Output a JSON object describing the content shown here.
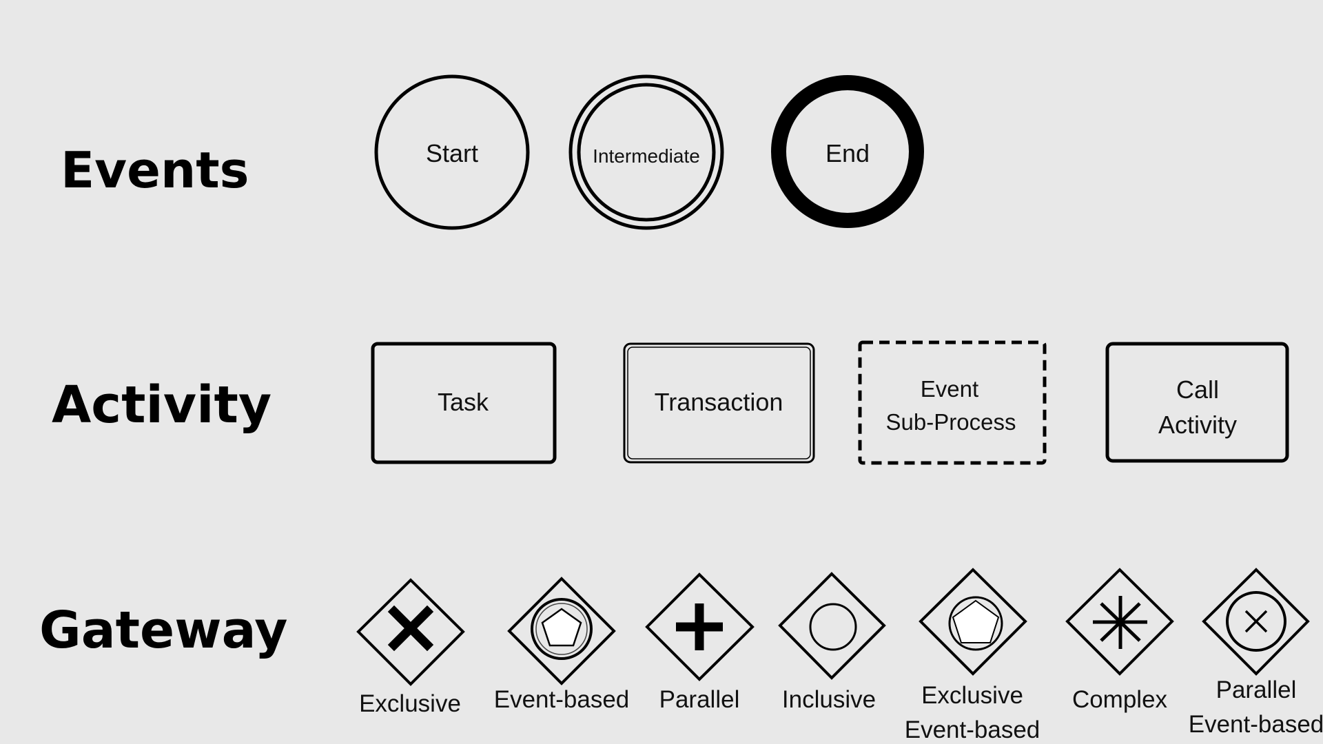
{
  "background_color": "#e8e8e8",
  "ink_color": "#000000",
  "sections": {
    "events": {
      "title": "Events",
      "items": [
        {
          "label": "Start",
          "shape": "circle-thin"
        },
        {
          "label": "Intermediate",
          "shape": "circle-double"
        },
        {
          "label": "End",
          "shape": "circle-thick"
        }
      ]
    },
    "activity": {
      "title": "Activity",
      "items": [
        {
          "label_lines": [
            "Task"
          ],
          "shape": "rounded-rect"
        },
        {
          "label_lines": [
            "Transaction"
          ],
          "shape": "rounded-rect-double"
        },
        {
          "label_lines": [
            "Event",
            "Sub-Process"
          ],
          "shape": "rounded-rect-dashed"
        },
        {
          "label_lines": [
            "Call",
            "Activity"
          ],
          "shape": "rounded-rect-thick"
        }
      ]
    },
    "gateway": {
      "title": "Gateway",
      "items": [
        {
          "label_lines": [
            "Exclusive"
          ],
          "marker": "x-bold-icon"
        },
        {
          "label_lines": [
            "Event-based"
          ],
          "marker": "double-circle-pentagon-icon"
        },
        {
          "label_lines": [
            "Parallel"
          ],
          "marker": "plus-bold-icon"
        },
        {
          "label_lines": [
            "Inclusive"
          ],
          "marker": "circle-icon"
        },
        {
          "label_lines": [
            "Exclusive",
            "Event-based"
          ],
          "marker": "circle-pentagon-icon"
        },
        {
          "label_lines": [
            "Complex"
          ],
          "marker": "asterisk-icon"
        },
        {
          "label_lines": [
            "Parallel",
            "Event-based"
          ],
          "marker": "circle-x-icon"
        }
      ]
    }
  }
}
